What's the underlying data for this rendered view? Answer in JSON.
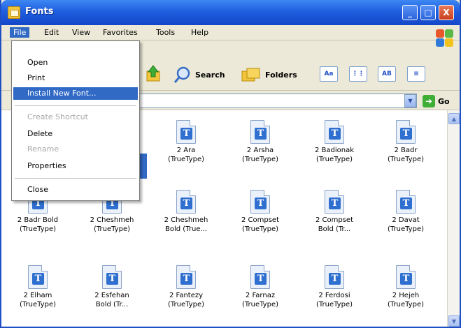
{
  "window": {
    "title": "Fonts"
  },
  "title_buttons": {
    "minimize": "_",
    "maximize": "□",
    "close": "X"
  },
  "menu": [
    "File",
    "Edit",
    "View",
    "Favorites",
    "Tools",
    "Help"
  ],
  "toolbar": {
    "search": "Search",
    "folders": "Folders",
    "view_buttons": [
      "Aa",
      "⋮⋮",
      "AB",
      "≡"
    ]
  },
  "address": {
    "go": "Go"
  },
  "file_menu": {
    "items": [
      {
        "label": "Open",
        "state": "normal"
      },
      {
        "label": "Print",
        "state": "normal"
      },
      {
        "label": "Install New Font...",
        "state": "highlighted"
      },
      {
        "label": "Create Shortcut",
        "state": "disabled"
      },
      {
        "label": "Delete",
        "state": "normal"
      },
      {
        "label": "Rename",
        "state": "disabled"
      },
      {
        "label": "Properties",
        "state": "normal"
      },
      {
        "label": "Close",
        "state": "normal"
      }
    ]
  },
  "fonts": [
    {
      "name": "2 Ara",
      "type": "(TrueType)"
    },
    {
      "name": "2 Arsha",
      "type": "(TrueType)"
    },
    {
      "name": "2 Badionak",
      "type": "(TrueType)"
    },
    {
      "name": "2 Badr",
      "type": "(TrueType)"
    },
    {
      "name": "2 Badr Bold",
      "type": "(TrueType)"
    },
    {
      "name": "2 Cheshmeh",
      "type": "(TrueType)"
    },
    {
      "name": "2 Cheshmeh",
      "type": "Bold (True..."
    },
    {
      "name": "2 Compset",
      "type": "(TrueType)"
    },
    {
      "name": "2 Compset",
      "type": "Bold (Tr..."
    },
    {
      "name": "2 Davat",
      "type": "(TrueType)"
    },
    {
      "name": "2 Elham",
      "type": "(TrueType)"
    },
    {
      "name": "2 Esfehan",
      "type": "Bold (Tr..."
    },
    {
      "name": "2 Fantezy",
      "type": "(TrueType)"
    },
    {
      "name": "2 Farnaz",
      "type": "(TrueType)"
    },
    {
      "name": "2 Ferdosi",
      "type": "(TrueType)"
    },
    {
      "name": "2 Hejeh",
      "type": "(TrueType)"
    }
  ],
  "font_glyph": "T",
  "colors": {
    "selection": "#316ac5",
    "titlebar": "#1f5fe0"
  }
}
